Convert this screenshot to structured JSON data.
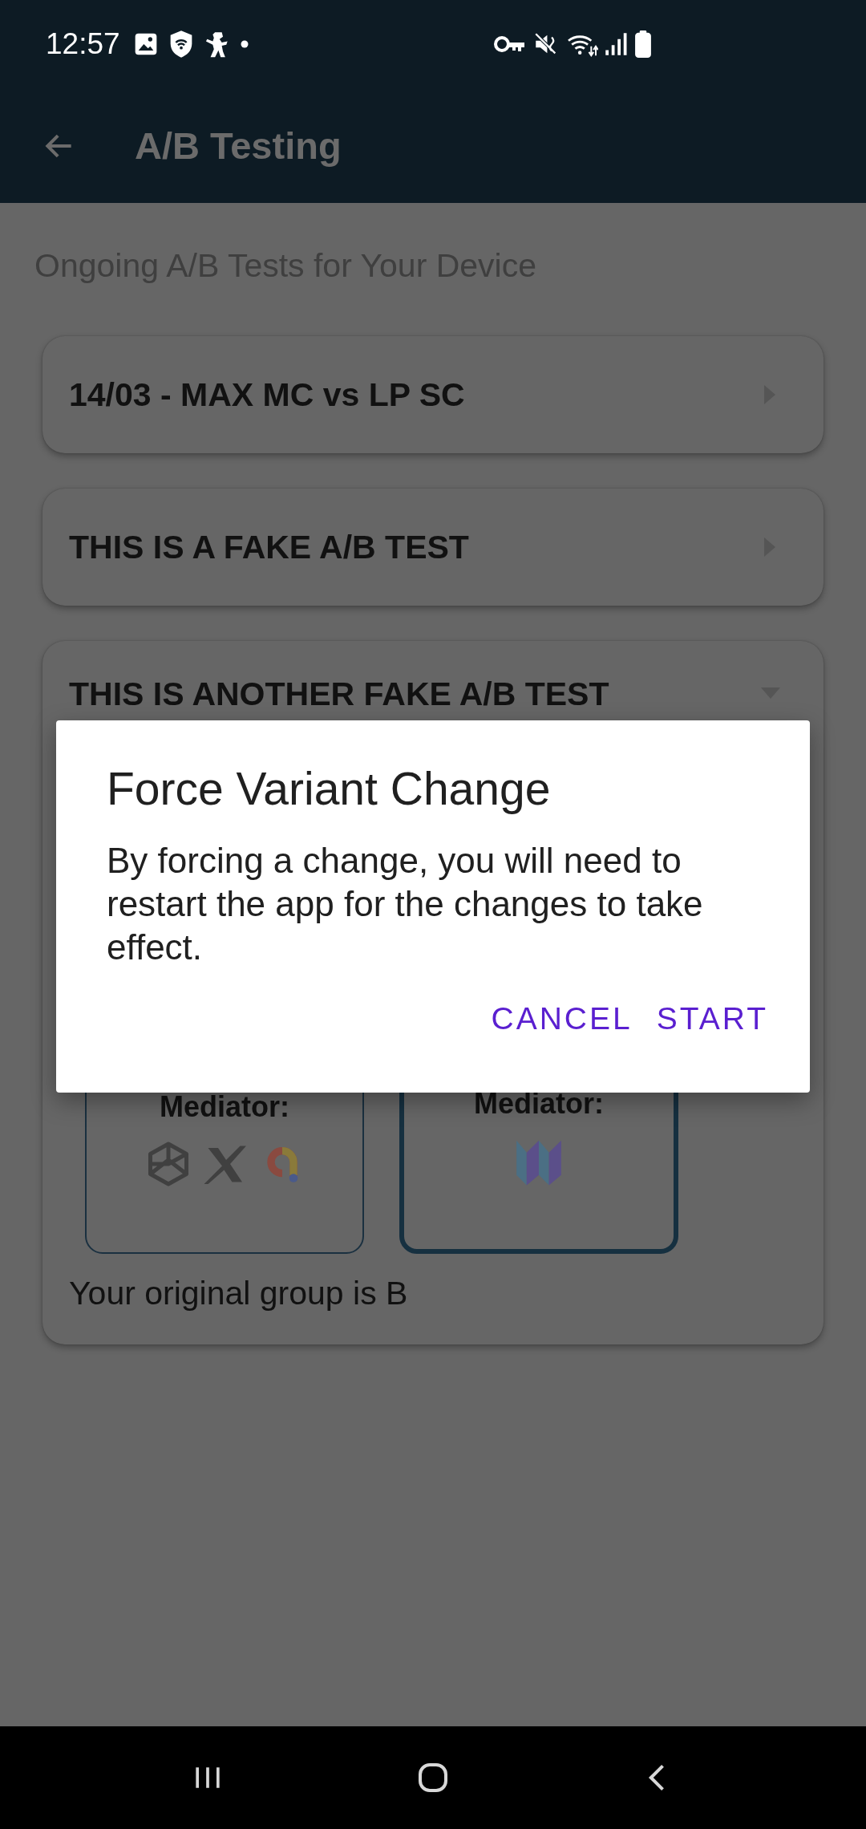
{
  "status_bar": {
    "time": "12:57"
  },
  "app_bar": {
    "title": "A/B Testing"
  },
  "heading": "Ongoing A/B Tests for Your Device",
  "tests": [
    {
      "title": "14/03 - MAX MC vs LP SC",
      "expanded": false
    },
    {
      "title": "THIS IS A FAKE A/B TEST",
      "expanded": false
    },
    {
      "title": "THIS IS ANOTHER FAKE A/B TEST",
      "expanded": true,
      "variants": [
        {
          "label": "Mediator:",
          "kind": "multi",
          "selected": false
        },
        {
          "label": "Mediator:",
          "kind": "single",
          "selected": true
        }
      ],
      "note": "Your original group is B"
    }
  ],
  "dialog": {
    "title": "Force Variant Change",
    "message": "By forcing a change, you will need to restart the app for the changes to take effect.",
    "buttons": [
      "CANCEL",
      "START"
    ]
  }
}
